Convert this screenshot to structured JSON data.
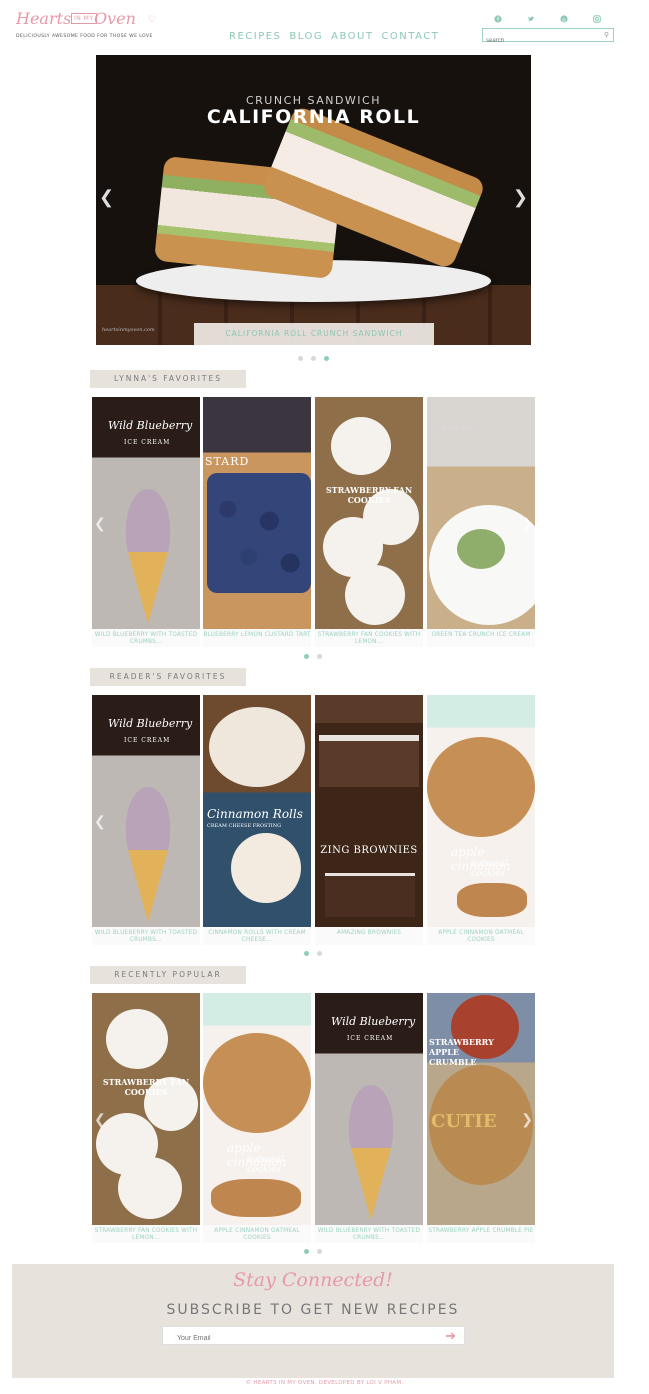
{
  "brand": {
    "name_part1": "Hearts",
    "name_part2": "IN MY",
    "name_part3": "Oven",
    "tagline": "DELICIOUSLY AWESOME FOOD FOR THOSE WE LOVE"
  },
  "nav": {
    "items": [
      "RECIPES",
      "BLOG",
      "ABOUT",
      "CONTACT"
    ]
  },
  "social": {
    "icons": [
      "facebook-icon",
      "twitter-icon",
      "pinterest-icon",
      "instagram-icon"
    ]
  },
  "search": {
    "placeholder": "search"
  },
  "hero": {
    "subtitle": "CRUNCH SANDWICH",
    "title": "CALIFORNIA ROLL",
    "caption": "CALIFORNIA ROLL CRUNCH SANDWICH",
    "watermark": "heartsinmyoven.com",
    "active_slide": 3,
    "slide_count": 3
  },
  "sections": [
    {
      "label": "LYNNA'S FAVORITES",
      "cards": [
        {
          "caption": "WILD BLUEBERRY WITH TOASTED CRUMBS...",
          "overlay": "Wild Blueberry",
          "overlay2": "ICE CREAM"
        },
        {
          "caption": "BLUEBERRY LEMON CUSTARD TART",
          "overlay": "STARD",
          "overlay2": ""
        },
        {
          "caption": "STRAWBERRY FAN COOKIES WITH LEMON...",
          "overlay": "STRAWBERRY FAN COOKIES",
          "overlay2": ""
        },
        {
          "caption": "GREEN TEA CRUNCH ICE CREAM",
          "overlay": "green tea",
          "overlay2": ""
        }
      ]
    },
    {
      "label": "READER'S FAVORITES",
      "cards": [
        {
          "caption": "WILD BLUEBERRY WITH TOASTED CRUMBS...",
          "overlay": "Wild Blueberry",
          "overlay2": "ICE CREAM"
        },
        {
          "caption": "CINNAMON ROLLS WITH CREAM CHEESE...",
          "overlay": "Cinnamon Rolls",
          "overlay2": "CREAM CHEESE FROSTING"
        },
        {
          "caption": "AMAZING BROWNIES",
          "overlay": "ZING BROWNIES",
          "overlay2": ""
        },
        {
          "caption": "APPLE CINNAMON OATMEAL COOKIES",
          "overlay": "apple cinnamon",
          "overlay2": "oatmeal cookies"
        }
      ]
    },
    {
      "label": "RECENTLY POPULAR",
      "cards": [
        {
          "caption": "STRAWBERRY FAN COOKIES WITH LEMON...",
          "overlay": "STRAWBERRY FAN COOKIES",
          "overlay2": ""
        },
        {
          "caption": "APPLE CINNAMON OATMEAL COOKIES",
          "overlay": "apple cinnamon",
          "overlay2": "oatmeal cookies"
        },
        {
          "caption": "WILD BLUEBERRY WITH TOASTED CRUMBS...",
          "overlay": "Wild Blueberry",
          "overlay2": "ICE CREAM"
        },
        {
          "caption": "STRAWBERRY APPLE CRUMBLE PIE",
          "overlay": "STRAWBERRY APPLE CRUMBLE",
          "overlay2": "CUTIE"
        }
      ]
    }
  ],
  "subscribe": {
    "script_title": "Stay Connected!",
    "title": "SUBSCRIBE TO GET NEW RECIPES",
    "email_placeholder": "Your Email"
  },
  "footer": {
    "copyright": "© HEARTS IN MY OVEN. DEVELOPED BY LOI V PHAM."
  },
  "colors": {
    "accent_pink": "#e69aa6",
    "accent_mint": "#8cc8b4",
    "panel_beige": "#e8e2dd"
  }
}
